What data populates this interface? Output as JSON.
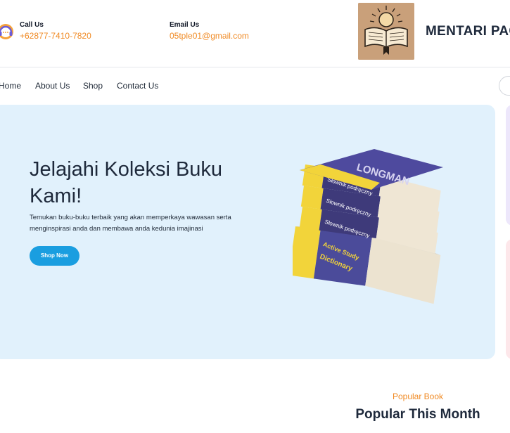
{
  "contact": {
    "call_label": "Call Us",
    "call_value": "+62877-7410-7820",
    "email_label": "Email Us",
    "email_value": "05tple01@gmail.com"
  },
  "brand": {
    "name": "MENTARI PAG"
  },
  "nav": {
    "items": [
      "Home",
      "About Us",
      "Shop",
      "Contact Us"
    ]
  },
  "hero": {
    "title": "Jelajahi Koleksi Buku Kami!",
    "description": "Temukan buku-buku terbaik yang akan memperkaya wawasan serta menginspirasi anda dan membawa anda kedunia imajinasi",
    "button_label": "Shop Now"
  },
  "book_labels": {
    "top_spine": "LONGMAN",
    "slownik_1": "Słownik podręczny",
    "slownik_2": "Słownik podręczny",
    "slownik_3": "Słownik podręczny",
    "bottom_1": "Active Study",
    "bottom_2": "Dictionary"
  },
  "popular": {
    "subtitle": "Popular Book",
    "title": "Popular This Month"
  },
  "colors": {
    "accent_orange": "#f08a24",
    "hero_bg": "#e1f1fc",
    "button_blue": "#1a9ee0",
    "dark_text": "#1e293b"
  }
}
